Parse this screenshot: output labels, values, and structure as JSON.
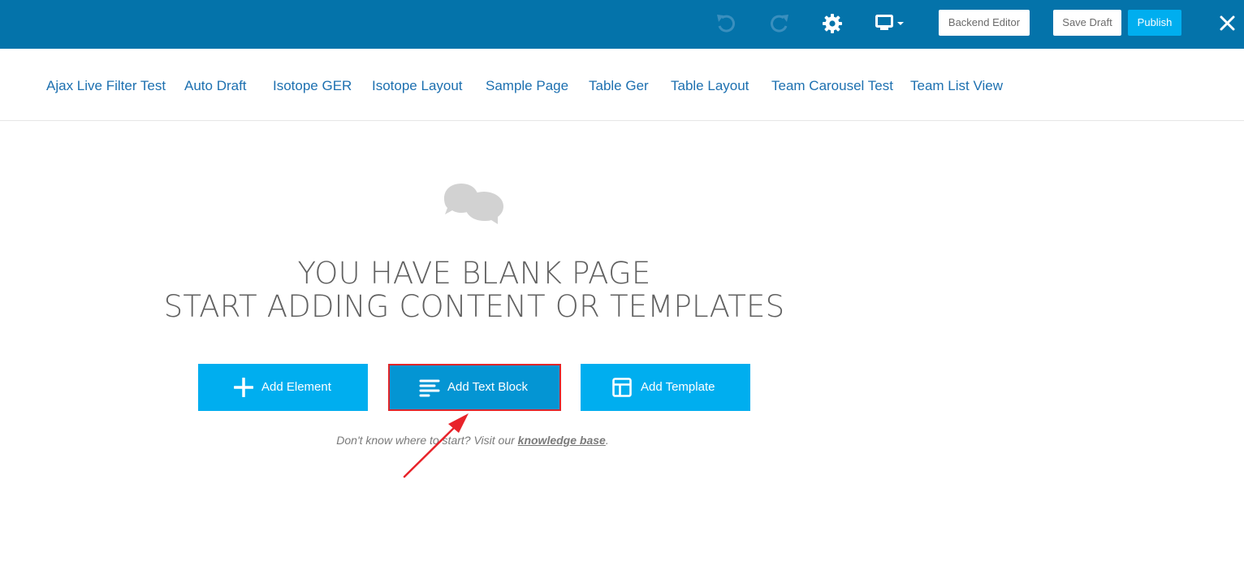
{
  "toolbar": {
    "undo_icon": "undo-icon",
    "redo_icon": "redo-icon",
    "settings_icon": "gear-icon",
    "device_icon": "monitor-dropdown-icon",
    "backend_editor_label": "Backend Editor",
    "save_draft_label": "Save Draft",
    "publish_label": "Publish",
    "close_icon": "close-icon"
  },
  "nav": {
    "links": [
      "Ajax Live Filter Test",
      "Auto Draft",
      "Isotope GER",
      "Isotope Layout",
      "Sample Page",
      "Table Ger",
      "Table Layout",
      "Team Carousel Test",
      "Team List View"
    ]
  },
  "blank": {
    "line1": "YOU HAVE BLANK PAGE",
    "line2": "START ADDING CONTENT OR TEMPLATES",
    "add_element_label": "Add Element",
    "add_text_block_label": "Add Text Block",
    "add_template_label": "Add Template",
    "hint_prefix": "Don't know where to start? Visit our ",
    "hint_link": "knowledge base",
    "hint_suffix": "."
  },
  "colors": {
    "topbar": "#0473aa",
    "accent": "#00aeef",
    "highlight": "#e0262a",
    "nav_link": "#1d70b0"
  }
}
